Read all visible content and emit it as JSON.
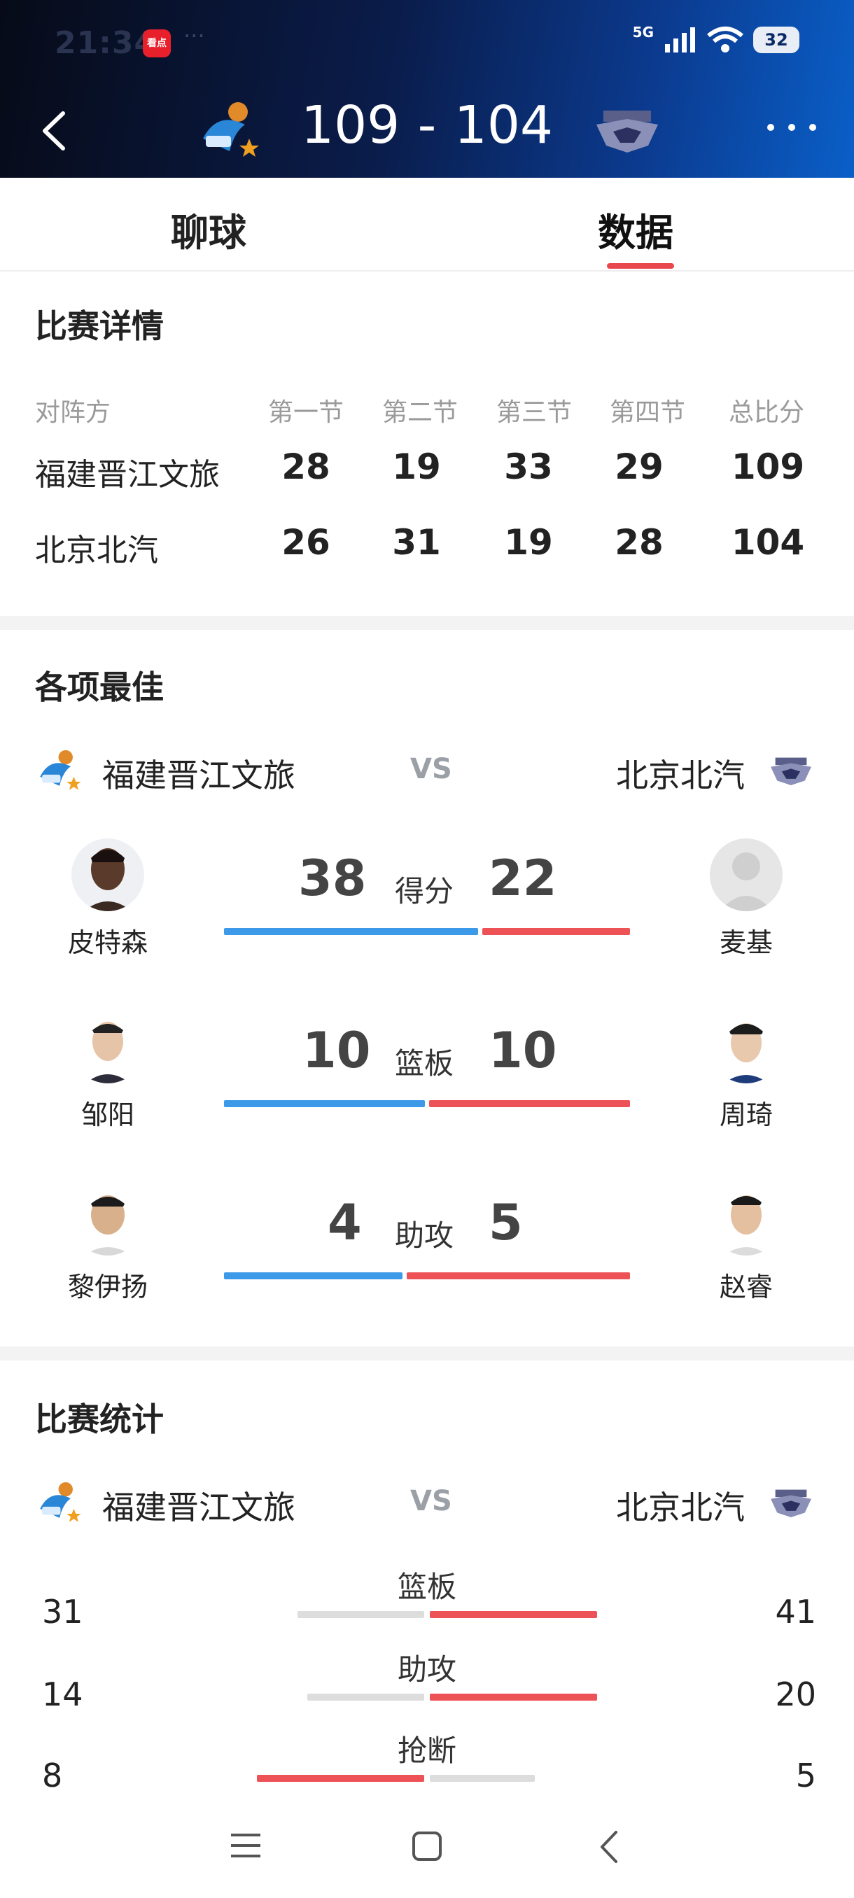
{
  "status_bar": {
    "time": "21:34",
    "app_badge": "看点",
    "dots": "···",
    "network": "5G",
    "battery": "32"
  },
  "header": {
    "home_score": "109",
    "separator": "-",
    "away_score": "104",
    "home_team_logo": "fujian-sturgeons-logo",
    "away_team_logo": "beijing-ducks-logo"
  },
  "tabs": [
    {
      "label": "聊球",
      "active": false
    },
    {
      "label": "数据",
      "active": true
    }
  ],
  "match_detail": {
    "title": "比赛详情",
    "headers": [
      "对阵方",
      "第一节",
      "第二节",
      "第三节",
      "第四节",
      "总比分"
    ],
    "rows": [
      {
        "team": "福建晋江文旅",
        "q1": "28",
        "q2": "19",
        "q3": "33",
        "q4": "29",
        "total": "109"
      },
      {
        "team": "北京北汽",
        "q1": "26",
        "q2": "31",
        "q3": "19",
        "q4": "28",
        "total": "104"
      }
    ]
  },
  "leaders": {
    "title": "各项最佳",
    "home_team": "福建晋江文旅",
    "vs": "VS",
    "away_team": "北京北汽",
    "rows": [
      {
        "category": "得分",
        "home_player": "皮特森",
        "home_value": "38",
        "away_player": "麦基",
        "away_value": "22",
        "home_share": 0.633
      },
      {
        "category": "篮板",
        "home_player": "邹阳",
        "home_value": "10",
        "away_player": "周琦",
        "away_value": "10",
        "home_share": 0.5
      },
      {
        "category": "助攻",
        "home_player": "黎伊扬",
        "home_value": "4",
        "away_player": "赵睿",
        "away_value": "5",
        "home_share": 0.444
      }
    ]
  },
  "stats": {
    "title": "比赛统计",
    "home_team": "福建晋江文旅",
    "vs": "VS",
    "away_team": "北京北汽",
    "rows": [
      {
        "label": "篮板",
        "home": "31",
        "away": "41"
      },
      {
        "label": "助攻",
        "home": "14",
        "away": "20"
      },
      {
        "label": "抢断",
        "home": "8",
        "away": "5"
      }
    ]
  },
  "colors": {
    "home": "#3d9ae8",
    "away": "#ed5257",
    "neutral": "#dddddd",
    "accent": "#e8474d"
  }
}
